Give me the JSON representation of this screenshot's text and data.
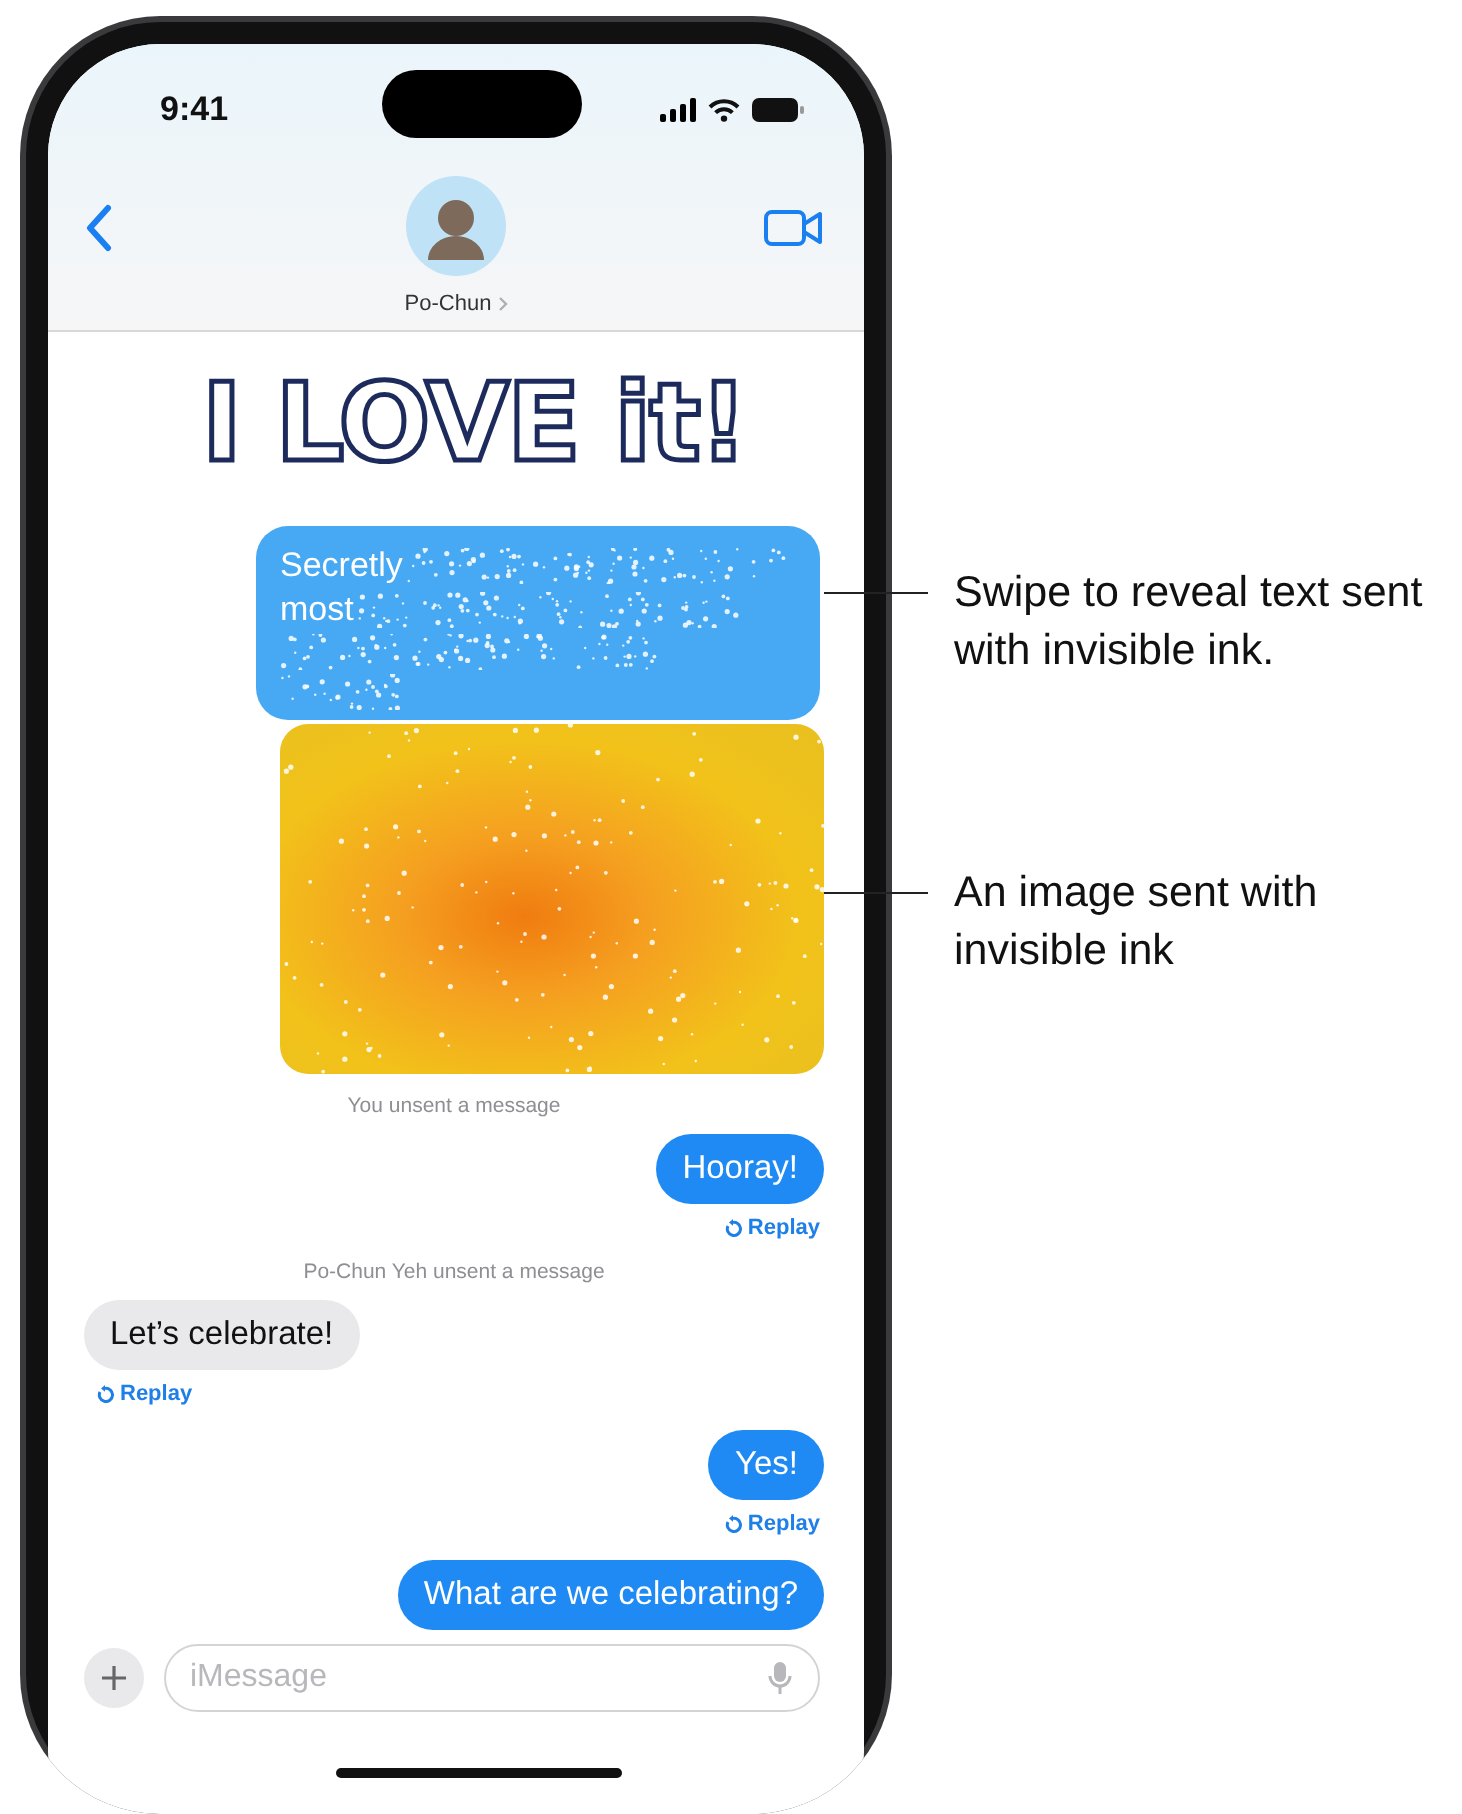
{
  "status_bar": {
    "time": "9:41"
  },
  "header": {
    "contact_name": "Po-Chun"
  },
  "messages": [
    {
      "kind": "handwriting",
      "text": "I LOVE it!"
    },
    {
      "kind": "ink_text",
      "visible_words": [
        "Secretly",
        "most"
      ]
    },
    {
      "kind": "ink_image"
    },
    {
      "kind": "notice",
      "text": "You unsent a message"
    },
    {
      "kind": "sent",
      "text": "Hooray!",
      "replay": "Replay"
    },
    {
      "kind": "notice",
      "text": "Po-Chun Yeh unsent a message"
    },
    {
      "kind": "received",
      "text": "Let’s celebrate!",
      "replay": "Replay"
    },
    {
      "kind": "sent",
      "text": "Yes!",
      "replay": "Replay"
    },
    {
      "kind": "sent",
      "text": "What are we celebrating?"
    }
  ],
  "composer": {
    "placeholder": "iMessage"
  },
  "callouts": [
    {
      "text": "Swipe to reveal text sent with invisible ink."
    },
    {
      "text": "An image sent with invisible ink"
    }
  ]
}
